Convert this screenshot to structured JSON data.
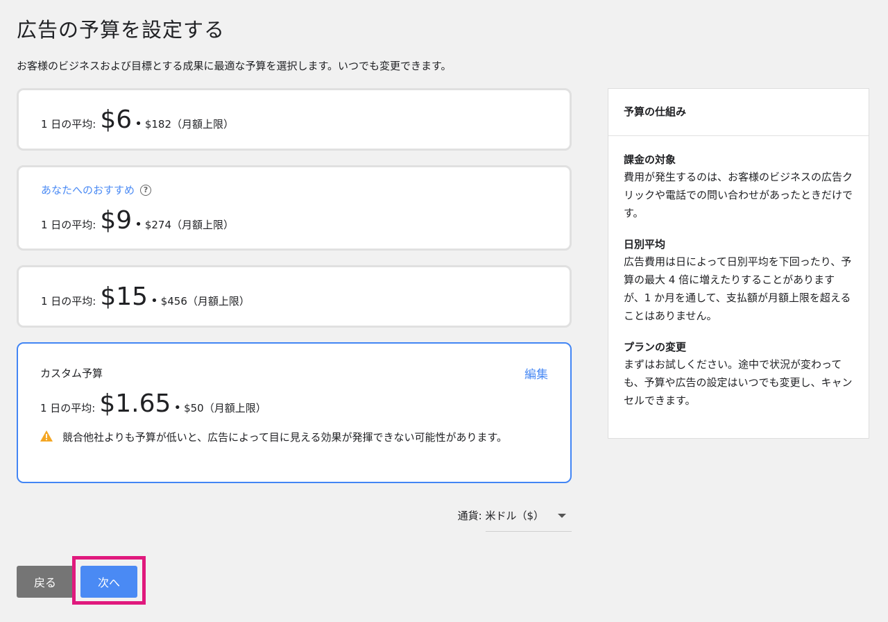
{
  "header": {
    "title": "広告の予算を設定する",
    "subtitle": "お客様のビジネスおよび目標とする成果に最適な予算を選択します。いつでも変更できます。"
  },
  "options": [
    {
      "daily_label": "1 日の平均:",
      "daily_price": "$6",
      "separator": "•",
      "monthly": "$182（月額上限）"
    },
    {
      "recommend_label": "あなたへのおすすめ",
      "help_icon": "?",
      "daily_label": "1 日の平均:",
      "daily_price": "$9",
      "separator": "•",
      "monthly": "$274（月額上限）"
    },
    {
      "daily_label": "1 日の平均:",
      "daily_price": "$15",
      "separator": "•",
      "monthly": "$456（月額上限）"
    }
  ],
  "custom": {
    "title": "カスタム予算",
    "edit_label": "編集",
    "daily_label": "1 日の平均:",
    "daily_price": "$1.65",
    "separator": "•",
    "monthly": "$50（月額上限）",
    "warning": "競合他社よりも予算が低いと、広告によって目に見える効果が発揮できない可能性があります。"
  },
  "currency": {
    "label": "通貨: 米ドル（$）"
  },
  "buttons": {
    "back": "戻る",
    "next": "次へ"
  },
  "side_panel": {
    "title": "予算の仕組み",
    "sections": [
      {
        "heading": "課金の対象",
        "body": "費用が発生するのは、お客様のビジネスの広告クリックや電話での問い合わせがあったときだけです。"
      },
      {
        "heading": "日別平均",
        "body": "広告費用は日によって日別平均を下回ったり、予算の最大 4 倍に増えたりすることがありますが、1 か月を通して、支払額が月額上限を超えることはありません。"
      },
      {
        "heading": "プランの変更",
        "body": "まずはお試しください。途中で状況が変わっても、予算や広告の設定はいつでも変更し、キャンセルできます。"
      }
    ]
  },
  "colors": {
    "accent": "#4a8af4",
    "highlight": "#e0197d",
    "warning": "#f4a623"
  }
}
